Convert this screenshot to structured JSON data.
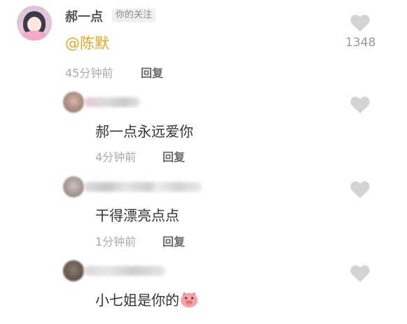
{
  "main_comment": {
    "username": "郝一点",
    "follow_tag": "你的关注",
    "mention": "@陈默",
    "time": "45分钟前",
    "reply_label": "回复",
    "like_count": "1348"
  },
  "replies": [
    {
      "text": "郝一点永远爱你",
      "time": "4分钟前",
      "reply_label": "回复"
    },
    {
      "text": "干得漂亮点点",
      "time": "1分钟前",
      "reply_label": "回复"
    },
    {
      "text": "小七姐是你的",
      "emoji": "pig-face"
    }
  ],
  "colors": {
    "mention": "#e9a52a",
    "heart": "#d4d4d4",
    "username": "#555555",
    "muted": "#aaaaaa"
  },
  "icons": [
    "heart-icon",
    "pig-face-emoji"
  ]
}
